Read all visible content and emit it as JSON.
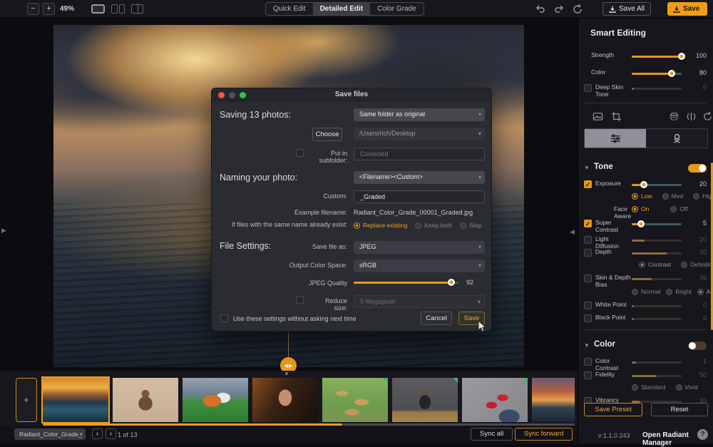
{
  "icons": {
    "minus": "−",
    "plus": "+",
    "caret": "▾",
    "check": "✓",
    "collapse": "▼",
    "tri_right": "▶",
    "tri_left": "◀",
    "prev": "‹",
    "next": "›",
    "help": "?",
    "add": "+",
    "handle_l": "◀",
    "handle_r": "▶",
    "sec_tri": "▼"
  },
  "toolbar": {
    "zoom_level": "49%",
    "tabs": [
      {
        "label": "Quick Edit"
      },
      {
        "label": "Detailed Edit"
      },
      {
        "label": "Color Grade"
      }
    ],
    "save_all_label": "Save All",
    "save_label": "Save"
  },
  "dialog": {
    "title": "Save files",
    "saving_label": "Saving 13 photos:",
    "folder_option": "Same folder as original",
    "choose_label": "Choose",
    "path_value": "/Users/rich/Desktop",
    "subfolder_label": "Put in subfolder:",
    "subfolder_placeholder": "Corrected",
    "naming_label": "Naming your photo:",
    "naming_option": "<Filename><Custom>",
    "custom_label": "Custom:",
    "custom_value": "_Graded",
    "example_label": "Example filename:",
    "example_value": "Radiant_Color_Grade_00001_Graded.jpg",
    "exist_label": "If files with the same name already exist:",
    "exist_options": [
      {
        "label": "Replace existing"
      },
      {
        "label": "Keep both"
      },
      {
        "label": "Stop"
      }
    ],
    "file_settings_label": "File Settings:",
    "save_as_label": "Save file as:",
    "save_as_value": "JPEG",
    "colorspace_label": "Output Color Space:",
    "colorspace_value": "sRGB",
    "quality_label": "JPEG Quality",
    "quality_value": "92",
    "reduce_label": "Reduce size:",
    "reduce_value": "5 Megapixel",
    "remember_label": "Use these settings without asking next time",
    "cancel_label": "Cancel",
    "save_label": "Save",
    "accent_color": "#f0a01e"
  },
  "sidebar": {
    "title": "Smart Editing",
    "smart": {
      "strength": {
        "label": "Strength",
        "value": "100"
      },
      "color": {
        "label": "Color",
        "value": "80"
      },
      "deep_skin": {
        "label": "Deep Skin Tone",
        "value": "0"
      }
    },
    "tone": {
      "header": "Tone",
      "exposure": {
        "label": "Exposure",
        "value": "20"
      },
      "exposure_modes": [
        {
          "label": "Low"
        },
        {
          "label": "Med"
        },
        {
          "label": "High"
        }
      ],
      "face_aware_label": "Face Aware",
      "face_aware_on": "On",
      "face_aware_off": "Off",
      "super_contrast": {
        "label": "Super Contrast",
        "value": "5"
      },
      "light_diffusion": {
        "label": "Light Diffusion",
        "value": "20"
      },
      "depth": {
        "label": "Depth",
        "value": "70"
      },
      "depth_modes": [
        {
          "label": "Contrast"
        },
        {
          "label": "Definition"
        }
      ],
      "skin_bias": {
        "label": "Skin & Depth Bias",
        "value": "76"
      },
      "skin_modes": [
        {
          "label": "Normal"
        },
        {
          "label": "Bright"
        },
        {
          "label": "Auto"
        }
      ],
      "white_point": {
        "label": "White Point",
        "value": "0"
      },
      "black_point": {
        "label": "Black Point",
        "value": "0"
      }
    },
    "color": {
      "header": "Color",
      "color_contrast": {
        "label": "Color Contrast",
        "value": "1"
      },
      "fidelity": {
        "label": "Fidelity",
        "value": "50"
      },
      "fidelity_modes": [
        {
          "label": "Standard"
        },
        {
          "label": "Vivid"
        }
      ],
      "vibrancy": {
        "label": "Vibrancy",
        "value": "10"
      }
    },
    "save_preset_label": "Save Preset",
    "reset_label": "Reset",
    "version": "v:1.1.0.243",
    "manager_label": "Open Radiant Manager"
  },
  "bottombar": {
    "filename": "Radiant_Color_Grade_",
    "counter": "1 of 13",
    "sync_all_label": "Sync all",
    "sync_forward_label": "Sync forward"
  }
}
